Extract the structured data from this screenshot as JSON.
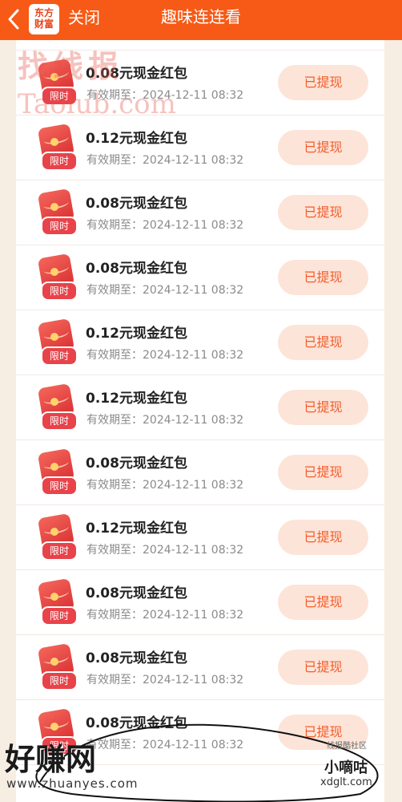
{
  "header": {
    "logo_line1": "东方",
    "logo_line2": "财富",
    "close_label": "关闭",
    "title": "趣味连连看",
    "bg_color": "#f75a16"
  },
  "rewards": [
    {
      "amount": "",
      "tag": "限时",
      "expiry": "有效期至：2024-12-11 08:32",
      "action": "已提现"
    },
    {
      "amount": "0.08元现金红包",
      "tag": "限时",
      "expiry": "有效期至：2024-12-11 08:32",
      "action": "已提现"
    },
    {
      "amount": "0.12元现金红包",
      "tag": "限时",
      "expiry": "有效期至：2024-12-11 08:32",
      "action": "已提现"
    },
    {
      "amount": "0.08元现金红包",
      "tag": "限时",
      "expiry": "有效期至：2024-12-11 08:32",
      "action": "已提现"
    },
    {
      "amount": "0.08元现金红包",
      "tag": "限时",
      "expiry": "有效期至：2024-12-11 08:32",
      "action": "已提现"
    },
    {
      "amount": "0.12元现金红包",
      "tag": "限时",
      "expiry": "有效期至：2024-12-11 08:32",
      "action": "已提现"
    },
    {
      "amount": "0.12元现金红包",
      "tag": "限时",
      "expiry": "有效期至：2024-12-11 08:32",
      "action": "已提现"
    },
    {
      "amount": "0.08元现金红包",
      "tag": "限时",
      "expiry": "有效期至：2024-12-11 08:32",
      "action": "已提现"
    },
    {
      "amount": "0.12元现金红包",
      "tag": "限时",
      "expiry": "有效期至：2024-12-11 08:32",
      "action": "已提现"
    },
    {
      "amount": "0.08元现金红包",
      "tag": "限时",
      "expiry": "有效期至：2024-12-11 08:32",
      "action": "已提现"
    },
    {
      "amount": "0.08元现金红包",
      "tag": "限时",
      "expiry": "有效期至：2024-12-11 08:32",
      "action": "已提现"
    },
    {
      "amount": "0.08元现金红包",
      "tag": "限时",
      "expiry": "有效期至：2024-12-11 08:32",
      "action": "已提现"
    }
  ],
  "watermarks": {
    "top_cn": "找线报",
    "top_en": "Taolub.com",
    "bottom_cn": "好赚网",
    "bottom_url": "www.zhuanyes.com",
    "right_small": "线报酷社区",
    "right_cn": "小嘀咕",
    "right_url": "xdglt.com"
  },
  "colors": {
    "accent": "#f75a16",
    "button_bg": "#fde4d8",
    "button_text": "#f45b2a",
    "page_bg": "#f7eee3"
  }
}
